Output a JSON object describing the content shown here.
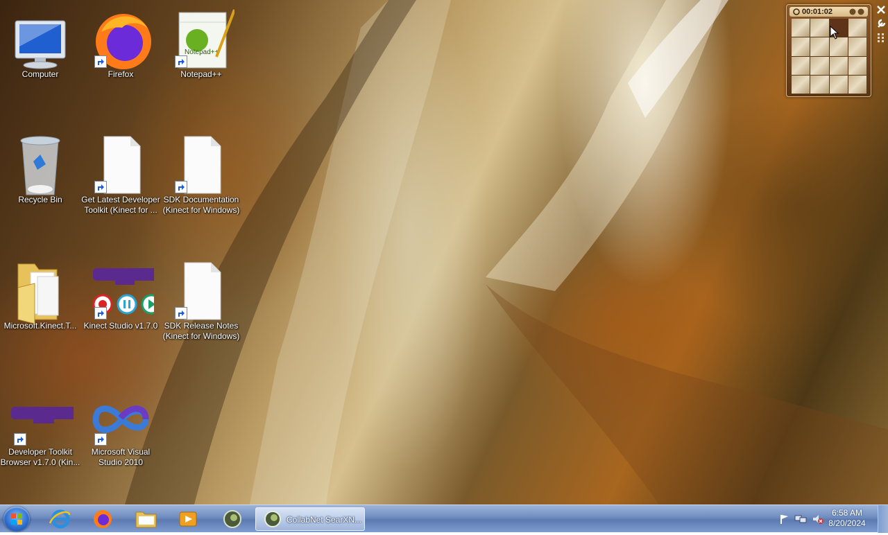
{
  "desktop": {
    "icons": [
      {
        "label": "Computer"
      },
      {
        "label": "Firefox"
      },
      {
        "label": "Notepad++"
      },
      {
        "label": "Recycle Bin"
      },
      {
        "label": "Get Latest Developer Toolkit (Kinect for ..."
      },
      {
        "label": "SDK Documentation (Kinect for Windows)"
      },
      {
        "label": "Microsoft.Kinect.T..."
      },
      {
        "label": "Kinect Studio v1.7.0"
      },
      {
        "label": "SDK Release Notes (Kinect for Windows)"
      },
      {
        "label": "Developer Toolkit Browser v1.7.0 (Kin..."
      },
      {
        "label": "Microsoft Visual Studio 2010"
      }
    ]
  },
  "gadget": {
    "timer": "00:01:02",
    "icon": "puzzle-icon"
  },
  "taskbar": {
    "pinned": [
      {
        "name": "internet-explorer-icon"
      },
      {
        "name": "firefox-icon"
      },
      {
        "name": "windows-explorer-icon"
      },
      {
        "name": "media-player-icon"
      },
      {
        "name": "collabnet-icon"
      }
    ],
    "active_task": "CollabNet SearXN...",
    "clock": {
      "time": "6:58 AM",
      "date": "8/20/2024"
    }
  },
  "colors": {
    "taskbar": "#6f8cc0",
    "label_text": "#ffffff"
  }
}
